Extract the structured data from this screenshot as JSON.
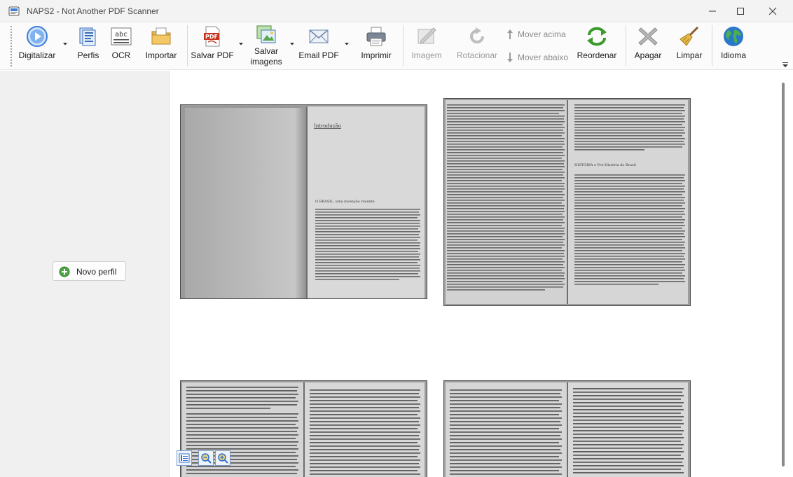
{
  "window": {
    "title": "NAPS2 - Not Another PDF Scanner"
  },
  "toolbar": {
    "scan": "Digitalizar",
    "profiles": "Perfis",
    "ocr": "OCR",
    "import": "Importar",
    "save_pdf": "Salvar PDF",
    "save_images_line1": "Salvar",
    "save_images_line2": "imagens",
    "email_pdf": "Email PDF",
    "print": "Imprimir",
    "image": "Imagem",
    "rotate": "Rotacionar",
    "move_up": "Mover acima",
    "move_down": "Mover abaixo",
    "reorder": "Reordenar",
    "delete": "Apagar",
    "clear": "Limpar",
    "language": "Idioma"
  },
  "left_pane": {
    "new_profile": "Novo perfil"
  },
  "pages": {
    "p1_heading": "Introdução",
    "p1_subheading": "O BRASIL, uma invenção recente",
    "p2_heading": "HISTÓRIA e Pré-História do Brasil"
  },
  "colors": {
    "accent": "#2f6fd0",
    "scan_icon": "#3b7dd8",
    "pdf_red": "#c8321e",
    "reorder_green": "#3a9a2a",
    "delete_gray": "#b5b5b5",
    "globe_blue": "#2a78c8"
  }
}
